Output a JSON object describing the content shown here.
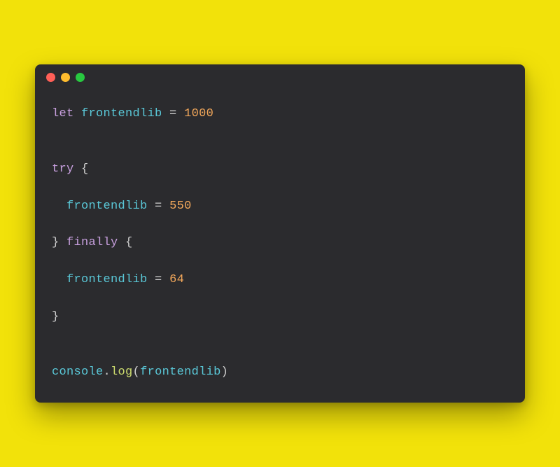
{
  "window": {
    "traffic_lights": [
      "close",
      "minimize",
      "zoom"
    ]
  },
  "code": {
    "lines": [
      {
        "indent": 0,
        "tokens": [
          {
            "t": "let ",
            "c": "keyword"
          },
          {
            "t": "frontendlib ",
            "c": "ident"
          },
          {
            "t": "= ",
            "c": "operator"
          },
          {
            "t": "1000",
            "c": "number"
          }
        ]
      },
      {
        "indent": 0,
        "tokens": []
      },
      {
        "indent": 0,
        "tokens": []
      },
      {
        "indent": 0,
        "tokens": [
          {
            "t": "try ",
            "c": "keyword"
          },
          {
            "t": "{",
            "c": "brace"
          }
        ]
      },
      {
        "indent": 0,
        "tokens": []
      },
      {
        "indent": 2,
        "tokens": [
          {
            "t": "frontendlib ",
            "c": "ident"
          },
          {
            "t": "= ",
            "c": "operator"
          },
          {
            "t": "550",
            "c": "number"
          }
        ]
      },
      {
        "indent": 0,
        "tokens": []
      },
      {
        "indent": 0,
        "tokens": [
          {
            "t": "} ",
            "c": "brace"
          },
          {
            "t": "finally ",
            "c": "keyword"
          },
          {
            "t": "{",
            "c": "brace"
          }
        ]
      },
      {
        "indent": 0,
        "tokens": []
      },
      {
        "indent": 2,
        "tokens": [
          {
            "t": "frontendlib ",
            "c": "ident"
          },
          {
            "t": "= ",
            "c": "operator"
          },
          {
            "t": "64",
            "c": "number"
          }
        ]
      },
      {
        "indent": 0,
        "tokens": []
      },
      {
        "indent": 0,
        "tokens": [
          {
            "t": "}",
            "c": "brace"
          }
        ]
      },
      {
        "indent": 0,
        "tokens": []
      },
      {
        "indent": 0,
        "tokens": []
      },
      {
        "indent": 0,
        "tokens": [
          {
            "t": "console",
            "c": "ident"
          },
          {
            "t": ".",
            "c": "operator"
          },
          {
            "t": "log",
            "c": "func"
          },
          {
            "t": "(",
            "c": "brace"
          },
          {
            "t": "frontendlib",
            "c": "ident"
          },
          {
            "t": ")",
            "c": "brace"
          }
        ]
      }
    ]
  }
}
